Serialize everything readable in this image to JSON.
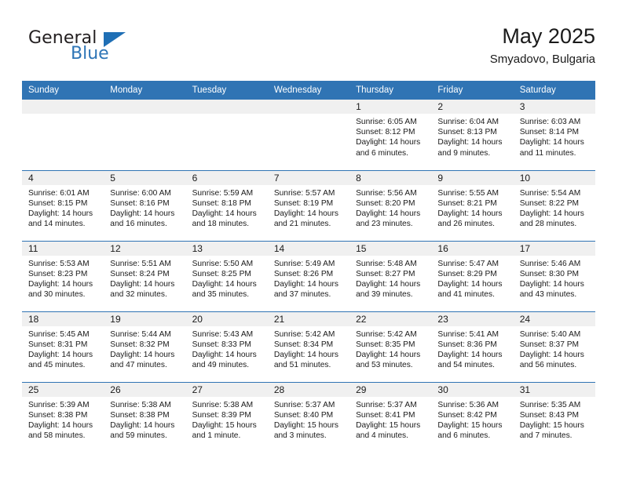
{
  "brand": {
    "word1": "General",
    "word2": "Blue",
    "logo_icon": "blue-triangle-icon",
    "accent_color": "#2e75b6"
  },
  "header": {
    "title": "May 2025",
    "subtitle": "Smyadovo, Bulgaria"
  },
  "theme": {
    "header_blue": "#3074b4",
    "daynum_gray": "#f0f0f0",
    "text": "#1a1a1a"
  },
  "columns": [
    "Sunday",
    "Monday",
    "Tuesday",
    "Wednesday",
    "Thursday",
    "Friday",
    "Saturday"
  ],
  "labels": {
    "sunrise": "Sunrise:",
    "sunset": "Sunset:",
    "daylight": "Daylight:"
  },
  "weeks": [
    [
      {
        "day": "",
        "empty": true
      },
      {
        "day": "",
        "empty": true
      },
      {
        "day": "",
        "empty": true
      },
      {
        "day": "",
        "empty": true
      },
      {
        "day": "1",
        "sunrise": "Sunrise: 6:05 AM",
        "sunset": "Sunset: 8:12 PM",
        "daylight": "Daylight: 14 hours and 6 minutes."
      },
      {
        "day": "2",
        "sunrise": "Sunrise: 6:04 AM",
        "sunset": "Sunset: 8:13 PM",
        "daylight": "Daylight: 14 hours and 9 minutes."
      },
      {
        "day": "3",
        "sunrise": "Sunrise: 6:03 AM",
        "sunset": "Sunset: 8:14 PM",
        "daylight": "Daylight: 14 hours and 11 minutes."
      }
    ],
    [
      {
        "day": "4",
        "sunrise": "Sunrise: 6:01 AM",
        "sunset": "Sunset: 8:15 PM",
        "daylight": "Daylight: 14 hours and 14 minutes."
      },
      {
        "day": "5",
        "sunrise": "Sunrise: 6:00 AM",
        "sunset": "Sunset: 8:16 PM",
        "daylight": "Daylight: 14 hours and 16 minutes."
      },
      {
        "day": "6",
        "sunrise": "Sunrise: 5:59 AM",
        "sunset": "Sunset: 8:18 PM",
        "daylight": "Daylight: 14 hours and 18 minutes."
      },
      {
        "day": "7",
        "sunrise": "Sunrise: 5:57 AM",
        "sunset": "Sunset: 8:19 PM",
        "daylight": "Daylight: 14 hours and 21 minutes."
      },
      {
        "day": "8",
        "sunrise": "Sunrise: 5:56 AM",
        "sunset": "Sunset: 8:20 PM",
        "daylight": "Daylight: 14 hours and 23 minutes."
      },
      {
        "day": "9",
        "sunrise": "Sunrise: 5:55 AM",
        "sunset": "Sunset: 8:21 PM",
        "daylight": "Daylight: 14 hours and 26 minutes."
      },
      {
        "day": "10",
        "sunrise": "Sunrise: 5:54 AM",
        "sunset": "Sunset: 8:22 PM",
        "daylight": "Daylight: 14 hours and 28 minutes."
      }
    ],
    [
      {
        "day": "11",
        "sunrise": "Sunrise: 5:53 AM",
        "sunset": "Sunset: 8:23 PM",
        "daylight": "Daylight: 14 hours and 30 minutes."
      },
      {
        "day": "12",
        "sunrise": "Sunrise: 5:51 AM",
        "sunset": "Sunset: 8:24 PM",
        "daylight": "Daylight: 14 hours and 32 minutes."
      },
      {
        "day": "13",
        "sunrise": "Sunrise: 5:50 AM",
        "sunset": "Sunset: 8:25 PM",
        "daylight": "Daylight: 14 hours and 35 minutes."
      },
      {
        "day": "14",
        "sunrise": "Sunrise: 5:49 AM",
        "sunset": "Sunset: 8:26 PM",
        "daylight": "Daylight: 14 hours and 37 minutes."
      },
      {
        "day": "15",
        "sunrise": "Sunrise: 5:48 AM",
        "sunset": "Sunset: 8:27 PM",
        "daylight": "Daylight: 14 hours and 39 minutes."
      },
      {
        "day": "16",
        "sunrise": "Sunrise: 5:47 AM",
        "sunset": "Sunset: 8:29 PM",
        "daylight": "Daylight: 14 hours and 41 minutes."
      },
      {
        "day": "17",
        "sunrise": "Sunrise: 5:46 AM",
        "sunset": "Sunset: 8:30 PM",
        "daylight": "Daylight: 14 hours and 43 minutes."
      }
    ],
    [
      {
        "day": "18",
        "sunrise": "Sunrise: 5:45 AM",
        "sunset": "Sunset: 8:31 PM",
        "daylight": "Daylight: 14 hours and 45 minutes."
      },
      {
        "day": "19",
        "sunrise": "Sunrise: 5:44 AM",
        "sunset": "Sunset: 8:32 PM",
        "daylight": "Daylight: 14 hours and 47 minutes."
      },
      {
        "day": "20",
        "sunrise": "Sunrise: 5:43 AM",
        "sunset": "Sunset: 8:33 PM",
        "daylight": "Daylight: 14 hours and 49 minutes."
      },
      {
        "day": "21",
        "sunrise": "Sunrise: 5:42 AM",
        "sunset": "Sunset: 8:34 PM",
        "daylight": "Daylight: 14 hours and 51 minutes."
      },
      {
        "day": "22",
        "sunrise": "Sunrise: 5:42 AM",
        "sunset": "Sunset: 8:35 PM",
        "daylight": "Daylight: 14 hours and 53 minutes."
      },
      {
        "day": "23",
        "sunrise": "Sunrise: 5:41 AM",
        "sunset": "Sunset: 8:36 PM",
        "daylight": "Daylight: 14 hours and 54 minutes."
      },
      {
        "day": "24",
        "sunrise": "Sunrise: 5:40 AM",
        "sunset": "Sunset: 8:37 PM",
        "daylight": "Daylight: 14 hours and 56 minutes."
      }
    ],
    [
      {
        "day": "25",
        "sunrise": "Sunrise: 5:39 AM",
        "sunset": "Sunset: 8:38 PM",
        "daylight": "Daylight: 14 hours and 58 minutes."
      },
      {
        "day": "26",
        "sunrise": "Sunrise: 5:38 AM",
        "sunset": "Sunset: 8:38 PM",
        "daylight": "Daylight: 14 hours and 59 minutes."
      },
      {
        "day": "27",
        "sunrise": "Sunrise: 5:38 AM",
        "sunset": "Sunset: 8:39 PM",
        "daylight": "Daylight: 15 hours and 1 minute."
      },
      {
        "day": "28",
        "sunrise": "Sunrise: 5:37 AM",
        "sunset": "Sunset: 8:40 PM",
        "daylight": "Daylight: 15 hours and 3 minutes."
      },
      {
        "day": "29",
        "sunrise": "Sunrise: 5:37 AM",
        "sunset": "Sunset: 8:41 PM",
        "daylight": "Daylight: 15 hours and 4 minutes."
      },
      {
        "day": "30",
        "sunrise": "Sunrise: 5:36 AM",
        "sunset": "Sunset: 8:42 PM",
        "daylight": "Daylight: 15 hours and 6 minutes."
      },
      {
        "day": "31",
        "sunrise": "Sunrise: 5:35 AM",
        "sunset": "Sunset: 8:43 PM",
        "daylight": "Daylight: 15 hours and 7 minutes."
      }
    ]
  ]
}
